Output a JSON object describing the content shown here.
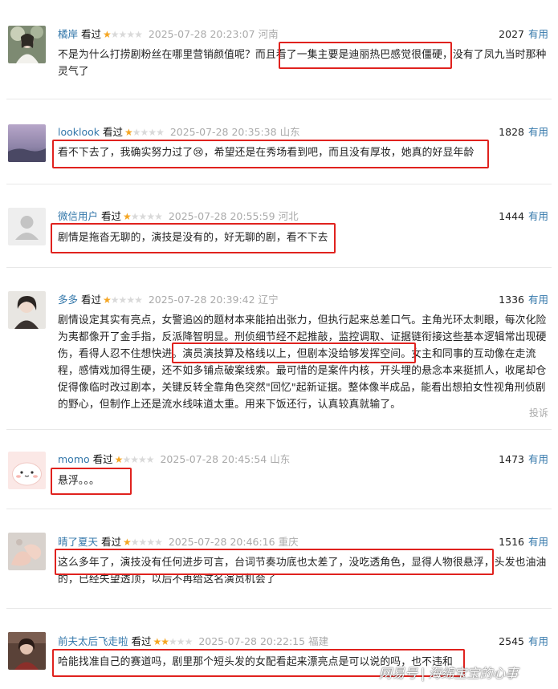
{
  "watermark": {
    "brand": "网易号",
    "sep": "|",
    "author": "海绵宝宝的心事"
  },
  "colors": {
    "user_link": "#3377aa",
    "star": "#f5a623",
    "highlight_box": "#e0221e"
  },
  "reviews": [
    {
      "user": "橘岸",
      "seen": "看过",
      "rating": 1,
      "time": "2025-07-28 20:23:07",
      "location": "河南",
      "votes": "2027",
      "useful": "有用",
      "text": "不是为什么打捞剧粉丝在哪里营销颜值呢？而且看了一集主要是迪丽热巴感觉很僵硬，没有了凤九当时那种灵气了"
    },
    {
      "user": "looklook",
      "seen": "看过",
      "rating": 1,
      "time": "2025-07-28 20:35:38",
      "location": "山东",
      "votes": "1828",
      "useful": "有用",
      "text": "看不下去了，我确实努力过了😢，希望还是在秀场看到吧，而且没有厚妆，她真的好显年龄"
    },
    {
      "user": "微信用户",
      "seen": "看过",
      "rating": 1,
      "time": "2025-07-28 20:55:59",
      "location": "河北",
      "votes": "1444",
      "useful": "有用",
      "text": "剧情是拖沓无聊的，演技是没有的，好无聊的剧，看不下去"
    },
    {
      "user": "多多",
      "seen": "看过",
      "rating": 1,
      "time": "2025-07-28 20:39:42",
      "location": "辽宁",
      "votes": "1336",
      "useful": "有用",
      "text": "剧情设定其实有亮点，女警追凶的题材本来能拍出张力，但执行起来总差口气。主角光环太刺眼，每次化险为夷都像开了金手指，反派降智明显。刑侦细节经不起推敲，监控调取、证据链衔接这些基本逻辑常出现硬伤，看得人忍不住想快进。演员演技算及格线以上，但剧本没给够发挥空间。女主和同事的互动像在走流程，感情戏加得生硬，还不如多铺点破案线索。最可惜的是案件内核，开头埋的悬念本来挺抓人，收尾却仓促得像临时改过剧本，关键反转全靠角色突然\"回忆\"起新证据。整体像半成品，能看出想拍女性视角刑侦剧的野心，但制作上还是流水线味道太重。用来下饭还行，认真较真就输了。",
      "report": "投诉"
    },
    {
      "user": "momo",
      "seen": "看过",
      "rating": 1,
      "time": "2025-07-28 20:45:54",
      "location": "山东",
      "votes": "1473",
      "useful": "有用",
      "text": "悬浮。。。"
    },
    {
      "user": "晴了夏天",
      "seen": "看过",
      "rating": 1,
      "time": "2025-07-28 20:46:16",
      "location": "重庆",
      "votes": "1516",
      "useful": "有用",
      "text": "这么多年了，演技没有任何进步可言，台词节奏功底也太差了，没吃透角色，显得人物很悬浮，头发也油油的，已经失望透顶，以后不再给这名演员机会了"
    },
    {
      "user": "前夫太后飞走啦",
      "seen": "看过",
      "rating": 2,
      "time": "2025-07-28 20:22:15",
      "location": "福建",
      "votes": "2545",
      "useful": "有用",
      "text": "哈能找准自己的赛道吗，剧里那个短头发的女配看起来漂亮点是可以说的吗，也不违和"
    }
  ]
}
